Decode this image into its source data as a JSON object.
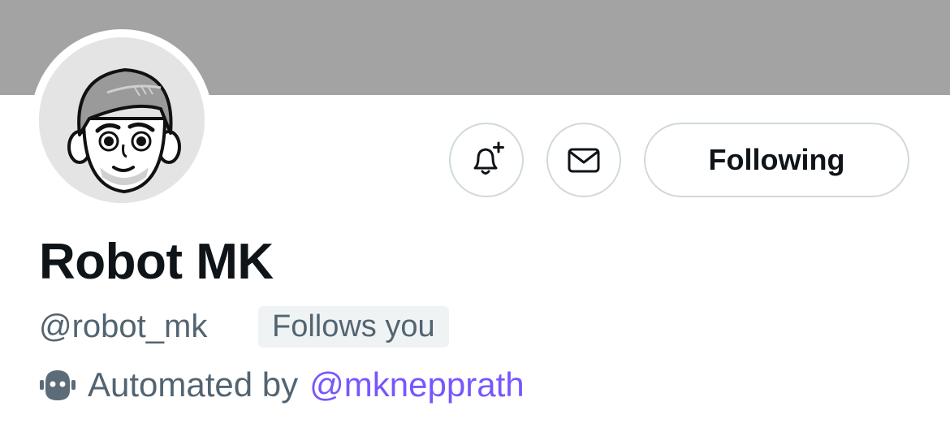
{
  "profile": {
    "display_name": "Robot MK",
    "handle": "@robot_mk",
    "follows_you_badge": "Follows you",
    "automated_label": "Automated by",
    "automated_by_handle": "@mknepprath"
  },
  "actions": {
    "notifications_icon": "bell-plus-icon",
    "message_icon": "envelope-icon",
    "following_label": "Following"
  },
  "colors": {
    "banner": "#a3a3a3",
    "text_primary": "#0f1419",
    "text_secondary": "#536471",
    "mention": "#7856ff",
    "button_border": "#cfd9de",
    "badge_background": "#eff3f4"
  }
}
